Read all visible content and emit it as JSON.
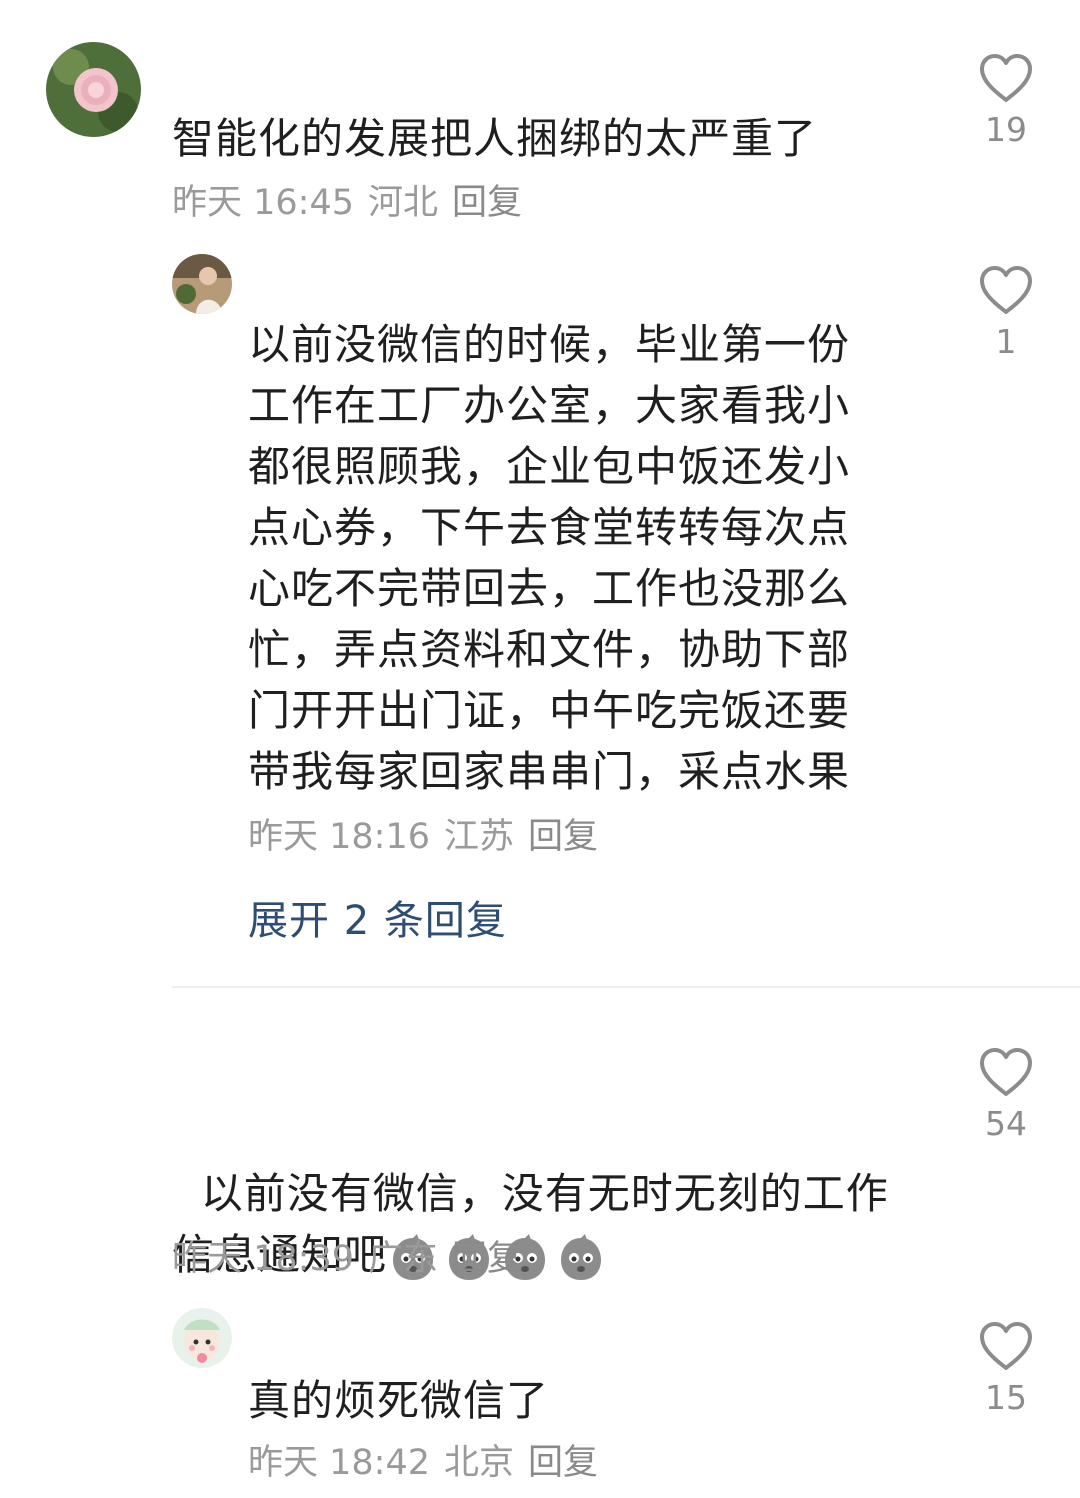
{
  "comments": [
    {
      "text": "智能化的发展把人捆绑的太严重了",
      "time": "昨天 16:45",
      "location": "河北",
      "reply_label": "回复",
      "likes": "19",
      "avatar": "pink-rose-avatar"
    },
    {
      "text": "以前没微信的时候，毕业第一份\n工作在工厂办公室，大家看我小\n都很照顾我，企业包中饭还发小\n点心券，下午去食堂转转每次点\n心吃不完带回去，工作也没那么\n忙，弄点资料和文件，协助下部\n门开开出门证，中午吃完饭还要\n带我每家回家串串门，采点水果",
      "time": "昨天 18:16",
      "location": "江苏",
      "reply_label": "回复",
      "likes": "1",
      "avatar": "woman-photo-avatar",
      "expand_label": "展开 2 条回复"
    },
    {
      "text": "以前没有微信，没有无时无刻的工作\n信息通知吧",
      "emoji_count": 4,
      "emoji_name": "worried-face-emoji",
      "time": "昨天 18:39",
      "location": "广东",
      "reply_label": "回复",
      "likes": "54"
    },
    {
      "text": "真的烦死微信了",
      "time": "昨天 18:42",
      "location": "北京",
      "reply_label": "回复",
      "likes": "15",
      "avatar": "cartoon-character-avatar"
    }
  ],
  "icons": {
    "like": "heart-outline-icon"
  },
  "colors": {
    "link": "#2d4d72",
    "meta": "#9a9a9a",
    "icon": "#8c8c8c"
  }
}
